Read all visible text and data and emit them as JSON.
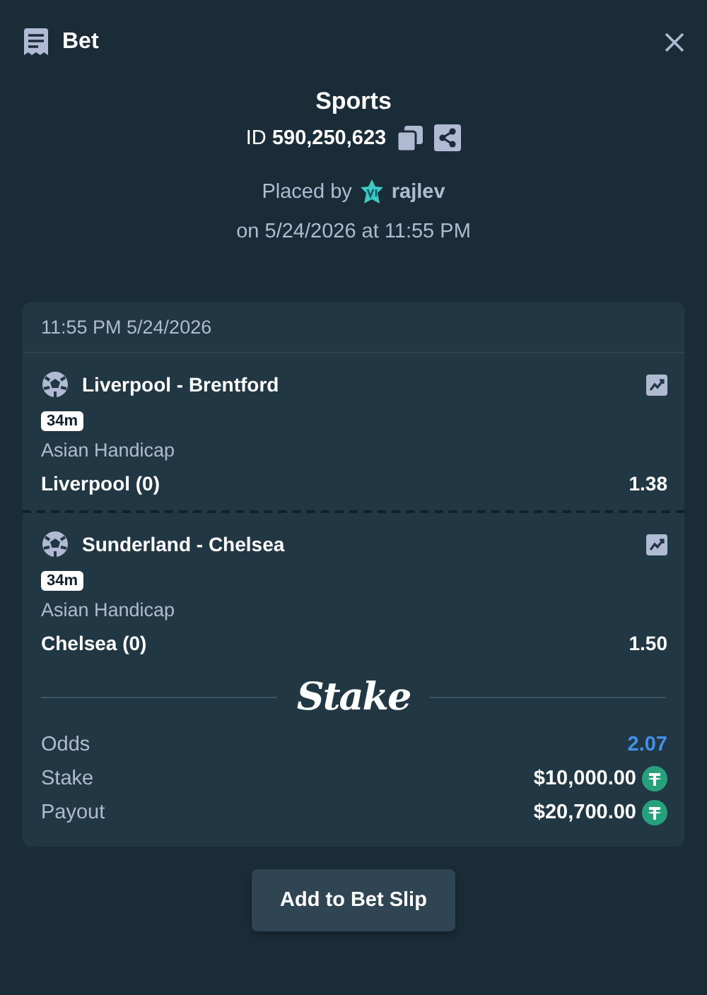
{
  "header": {
    "title": "Bet"
  },
  "bet": {
    "category": "Sports",
    "id_label": "ID",
    "id": "590,250,623",
    "placed_by": "Placed by",
    "user": "rajlev",
    "placed_on": "on 5/24/2026 at 11:55 PM"
  },
  "card": {
    "timestamp": "11:55 PM 5/24/2026",
    "legs": [
      {
        "event": "Liverpool - Brentford",
        "badge": "34m",
        "market": "Asian Handicap",
        "selection": "Liverpool (0)",
        "odds": "1.38"
      },
      {
        "event": "Sunderland - Chelsea",
        "badge": "34m",
        "market": "Asian Handicap",
        "selection": "Chelsea (0)",
        "odds": "1.50"
      }
    ],
    "brand": "Stake",
    "summary": [
      {
        "kind": "odds",
        "label": "Odds",
        "value": "2.07"
      },
      {
        "kind": "amount",
        "label": "Stake",
        "value": "$10,000.00"
      },
      {
        "kind": "amount",
        "label": "Payout",
        "value": "$20,700.00"
      }
    ]
  },
  "button": "Add to Bet Slip"
}
